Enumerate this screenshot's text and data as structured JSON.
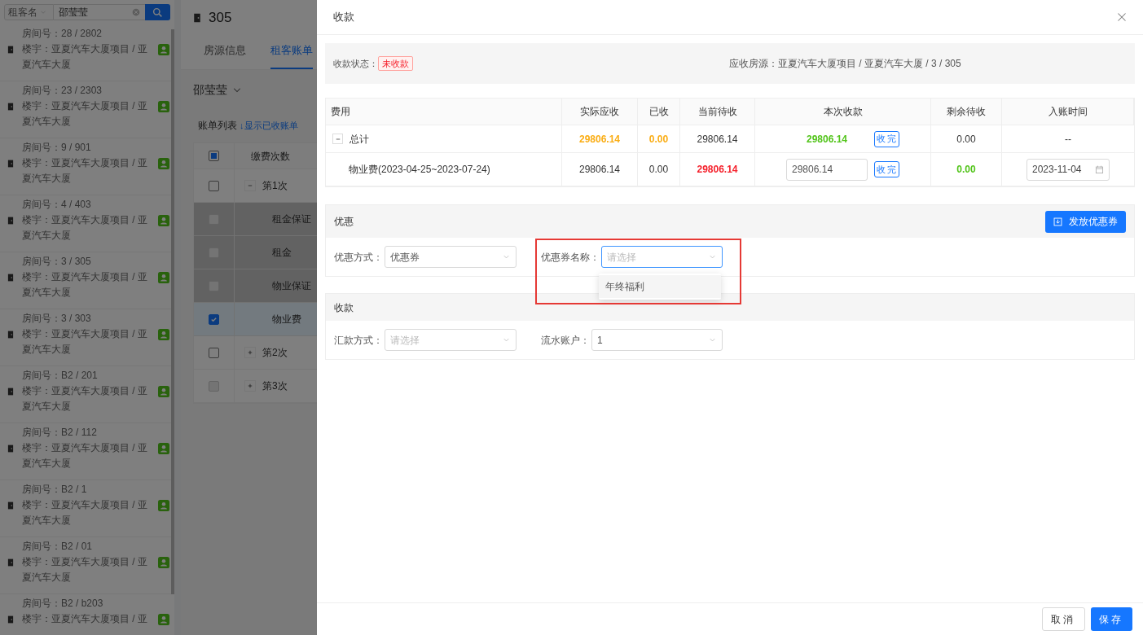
{
  "sidebar": {
    "search": {
      "field": "租客名",
      "value": "邵莹莹"
    },
    "items": [
      {
        "room": "房间号：28 / 2802",
        "building": "楼宇：亚夏汽车大厦项目 / 亚夏汽车大厦"
      },
      {
        "room": "房间号：23 / 2303",
        "building": "楼宇：亚夏汽车大厦项目 / 亚夏汽车大厦"
      },
      {
        "room": "房间号：9 / 901",
        "building": "楼宇：亚夏汽车大厦项目 / 亚夏汽车大厦"
      },
      {
        "room": "房间号：4 / 403",
        "building": "楼宇：亚夏汽车大厦项目 / 亚夏汽车大厦"
      },
      {
        "room": "房间号：3 / 305",
        "building": "楼宇：亚夏汽车大厦项目 / 亚夏汽车大厦"
      },
      {
        "room": "房间号：3 / 303",
        "building": "楼宇：亚夏汽车大厦项目 / 亚夏汽车大厦"
      },
      {
        "room": "房间号：B2 / 201",
        "building": "楼宇：亚夏汽车大厦项目 / 亚夏汽车大厦"
      },
      {
        "room": "房间号：B2 / 112",
        "building": "楼宇：亚夏汽车大厦项目 / 亚夏汽车大厦"
      },
      {
        "room": "房间号：B2 / 1",
        "building": "楼宇：亚夏汽车大厦项目 / 亚夏汽车大厦"
      },
      {
        "room": "房间号：B2 / 01",
        "building": "楼宇：亚夏汽车大厦项目 / 亚夏汽车大厦"
      },
      {
        "room": "房间号：B2 / b203",
        "building": "楼宇：亚夏汽车大厦项目 / 亚"
      }
    ]
  },
  "room_panel": {
    "title": "305",
    "tabs": [
      {
        "label": "房源信息",
        "selected": false
      },
      {
        "label": "租客账单",
        "selected": true
      }
    ],
    "tenant": "邵莹莹",
    "bill_list_label": "账单列表",
    "show_paid_link": "↓显示已收账单",
    "table": {
      "header": {
        "label": "缴费次数",
        "checked": false,
        "indeterminate": true
      },
      "rows": [
        {
          "label": "第1次",
          "expanded": true,
          "checked": false,
          "disabled": false,
          "children": [
            {
              "label": "租金保证",
              "checked": false,
              "disabled": true
            },
            {
              "label": "租金",
              "checked": false,
              "disabled": true
            },
            {
              "label": "物业保证",
              "checked": false,
              "disabled": true
            },
            {
              "label": "物业费",
              "checked": true,
              "disabled": false
            }
          ]
        },
        {
          "label": "第2次",
          "expanded": false,
          "checked": false,
          "disabled": false
        },
        {
          "label": "第3次",
          "expanded": false,
          "checked": false,
          "disabled": true
        }
      ]
    }
  },
  "drawer": {
    "title": "收款",
    "summary": {
      "status_label": "收款状态：",
      "status": "未收款",
      "source": "应收房源：亚夏汽车大厦项目 / 亚夏汽车大厦 / 3 / 305"
    },
    "fee_table": {
      "columns": [
        "费用",
        "实际应收",
        "已收",
        "当前待收",
        "本次收款",
        "剩余待收",
        "入账时间"
      ],
      "rows": [
        {
          "kind": "total",
          "name": "总计",
          "expanded": true,
          "actual": {
            "text": "29806.14",
            "color": "#faad14",
            "bold": true
          },
          "received": {
            "text": "0.00",
            "color": "#faad14",
            "bold": true
          },
          "pending": {
            "text": "29806.14",
            "color": "#333333",
            "bold": false
          },
          "collect": {
            "kind": "text",
            "value": "29806.14",
            "color": "#52c41a",
            "bold": true,
            "button": "收完"
          },
          "remaining": {
            "text": "0.00",
            "color": "#333333",
            "bold": false
          },
          "booked": {
            "kind": "text",
            "value": "--"
          }
        },
        {
          "kind": "item",
          "name": "物业费(2023-04-25~2023-07-24)",
          "actual": {
            "text": "29806.14",
            "color": "#333333",
            "bold": false
          },
          "received": {
            "text": "0.00",
            "color": "#333333",
            "bold": false
          },
          "pending": {
            "text": "29806.14",
            "color": "#f5222d",
            "bold": true
          },
          "collect": {
            "kind": "input",
            "value": "29806.14",
            "button": "收完"
          },
          "remaining": {
            "text": "0.00",
            "color": "#52c41a",
            "bold": true
          },
          "booked": {
            "kind": "date",
            "value": "2023-11-04"
          }
        }
      ]
    },
    "discount": {
      "title": "优惠",
      "issue_button": "发放优惠券",
      "fields": [
        {
          "label": "优惠方式：",
          "value": "优惠券",
          "focused": false
        },
        {
          "label": "优惠券名称：",
          "placeholder": "请选择",
          "focused": true,
          "highlighted": true,
          "options": [
            "年终福利"
          ]
        }
      ]
    },
    "payment": {
      "title": "收款",
      "fields": [
        {
          "label": "汇款方式：",
          "placeholder": "请选择",
          "focused": false
        },
        {
          "label": "流水账户：",
          "value": "1",
          "focused": false
        }
      ]
    },
    "footer": {
      "cancel": "取消",
      "save": "保存"
    }
  }
}
